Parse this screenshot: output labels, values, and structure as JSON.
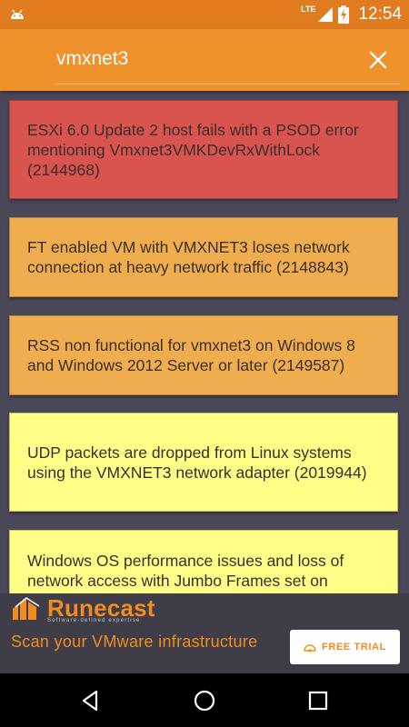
{
  "status_bar": {
    "network": "LTE",
    "time": "12:54"
  },
  "search": {
    "value": "vmxnet3"
  },
  "results": [
    {
      "text": "ESXi 6.0 Update 2 host fails with a PSOD error mentioning Vmxnet3VMKDevRxWithLock (2144968)",
      "color": "#d9534f"
    },
    {
      "text": "FT enabled VM with VMXNET3 loses network connection at heavy network traffic (2148843)",
      "color": "#f0ad4e"
    },
    {
      "text": "RSS non functional for vmxnet3 on Windows 8 and Windows 2012 Server or later (2149587)",
      "color": "#f0ad4e"
    },
    {
      "text": "UDP packets are dropped from Linux systems using the VMXNET3 network adapter (2019944)",
      "color": "#ffff88"
    },
    {
      "text": "Windows OS performance issues and loss of network access with Jumbo Frames set on",
      "color": "#ffff88"
    }
  ],
  "ad": {
    "brand": "Runecast",
    "tagline": "Software-defined expertise",
    "headline": "Scan your VMware infrastructure",
    "button_label": "FREE TRIAL",
    "accent": "#f28c1e"
  },
  "nav": {
    "back": "back-icon",
    "home": "home-icon",
    "recents": "recents-icon"
  }
}
